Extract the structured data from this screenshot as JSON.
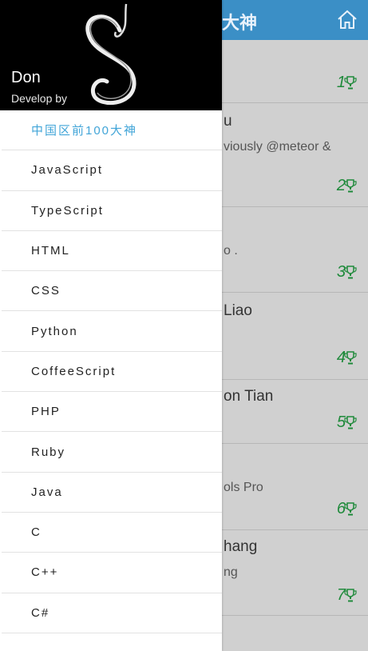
{
  "appbar": {
    "title": "大神"
  },
  "rows": [
    {
      "name": "",
      "desc": "",
      "rank": "1"
    },
    {
      "name": "u",
      "desc": "viously @meteor &",
      "rank": "2"
    },
    {
      "name": "",
      "desc": "o .",
      "rank": "3"
    },
    {
      "name": "Liao",
      "desc": "",
      "rank": "4"
    },
    {
      "name": "on Tian",
      "desc": "",
      "rank": "5"
    },
    {
      "name": "",
      "desc": "ols Pro",
      "rank": "6"
    },
    {
      "name": "hang",
      "desc": "ng",
      "rank": "7"
    }
  ],
  "drawer": {
    "user_name": "Don",
    "user_sub": "Develop by",
    "items": [
      {
        "label": "中国区前100大神"
      },
      {
        "label": "JavaScript"
      },
      {
        "label": "TypeScript"
      },
      {
        "label": "HTML"
      },
      {
        "label": "CSS"
      },
      {
        "label": "Python"
      },
      {
        "label": "CoffeeScript"
      },
      {
        "label": "PHP"
      },
      {
        "label": "Ruby"
      },
      {
        "label": "Java"
      },
      {
        "label": "C"
      },
      {
        "label": "C++"
      },
      {
        "label": "C#"
      }
    ]
  },
  "icons": {
    "home": "home-icon",
    "trophy": "trophy-icon",
    "logo": "s-logo"
  },
  "colors": {
    "appbar": "#3b8fc6",
    "active": "#42a5d8",
    "rank": "#1f8a3b"
  }
}
